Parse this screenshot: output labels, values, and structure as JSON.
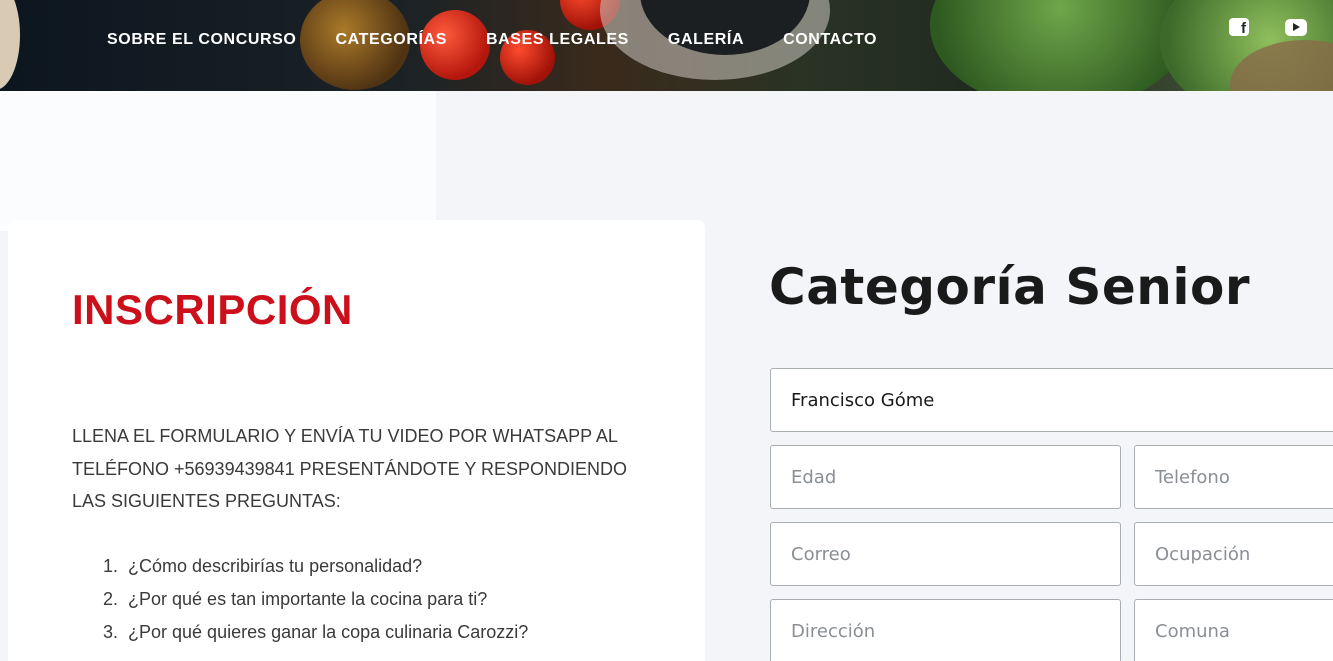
{
  "header": {
    "nav": [
      {
        "label": "SOBRE EL CONCURSO"
      },
      {
        "label": "CATEGORÍAS"
      },
      {
        "label": "BASES LEGALES"
      },
      {
        "label": "GALERÍA"
      },
      {
        "label": "CONTACTO"
      }
    ],
    "social": [
      "facebook-icon",
      "youtube-icon"
    ]
  },
  "inscripcion": {
    "title": "INSCRIPCIÓN",
    "intro": "LLENA EL FORMULARIO Y ENVÍA TU VIDEO POR WHATSAPP AL TELÉFONO +56939439841 PRESENTÁNDOTE Y RESPONDIENDO LAS SIGUIENTES PREGUNTAS:",
    "questions": [
      {
        "num": "1.",
        "text": "¿Cómo describirías tu personalidad?"
      },
      {
        "num": "2.",
        "text": "¿Por qué es tan importante la cocina para ti?"
      },
      {
        "num": "3.",
        "text": "¿Por qué quieres ganar la copa culinaria Carozzi?"
      }
    ]
  },
  "form": {
    "title": "Categoría Senior",
    "name_value": "Francisco Góme",
    "edad_placeholder": "Edad",
    "telefono_placeholder": "Telefono",
    "correo_placeholder": "Correo",
    "ocupacion_placeholder": "Ocupación",
    "direccion_placeholder": "Dirección",
    "comuna_placeholder": "Comuna"
  },
  "colors": {
    "accent_red": "#cc0f1a",
    "page_bg": "#f3f5f8"
  }
}
